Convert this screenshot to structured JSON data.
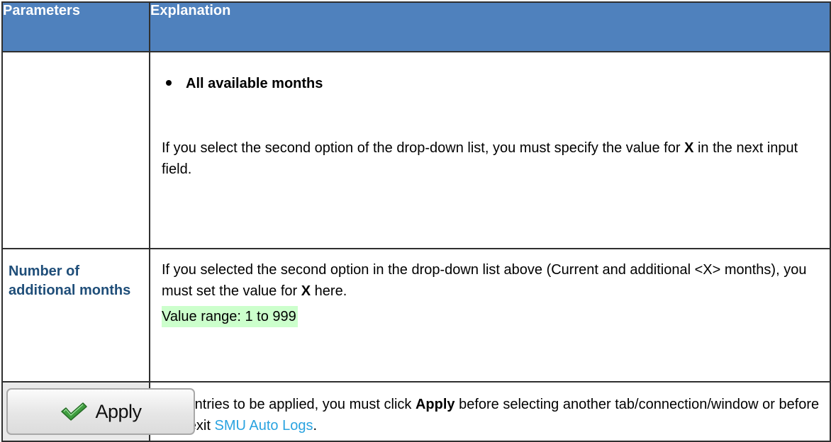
{
  "header": {
    "col_parameters": "Parameters",
    "col_explanation": "Explanation"
  },
  "rows": [
    {
      "parameter": "",
      "bullet": "All available months",
      "text_before": "If you select the second option of the drop-down list, you must specify the value for ",
      "text_bold": "X",
      "text_after": " in the next input field."
    },
    {
      "parameter": "Number of additional months",
      "text_before": "If you selected the second option in the drop-down list above (Current and additional <X> months), you must set the value for ",
      "text_bold": "X",
      "text_after": " here.",
      "range": "Value range: 1 to 999"
    },
    {
      "button_label": "Apply",
      "button_icon": "checkmark-icon",
      "text_before": "For entries to be applied, you must click ",
      "text_bold": "Apply",
      "text_middle": " before selecting another tab/connection/window or before you exit ",
      "link_text": "SMU Auto Logs",
      "text_after": "."
    }
  ],
  "colors": {
    "header_bg": "#4f81bd",
    "param_text": "#1f4e79",
    "highlight": "#ccffcc",
    "link": "#2aa3e0"
  }
}
